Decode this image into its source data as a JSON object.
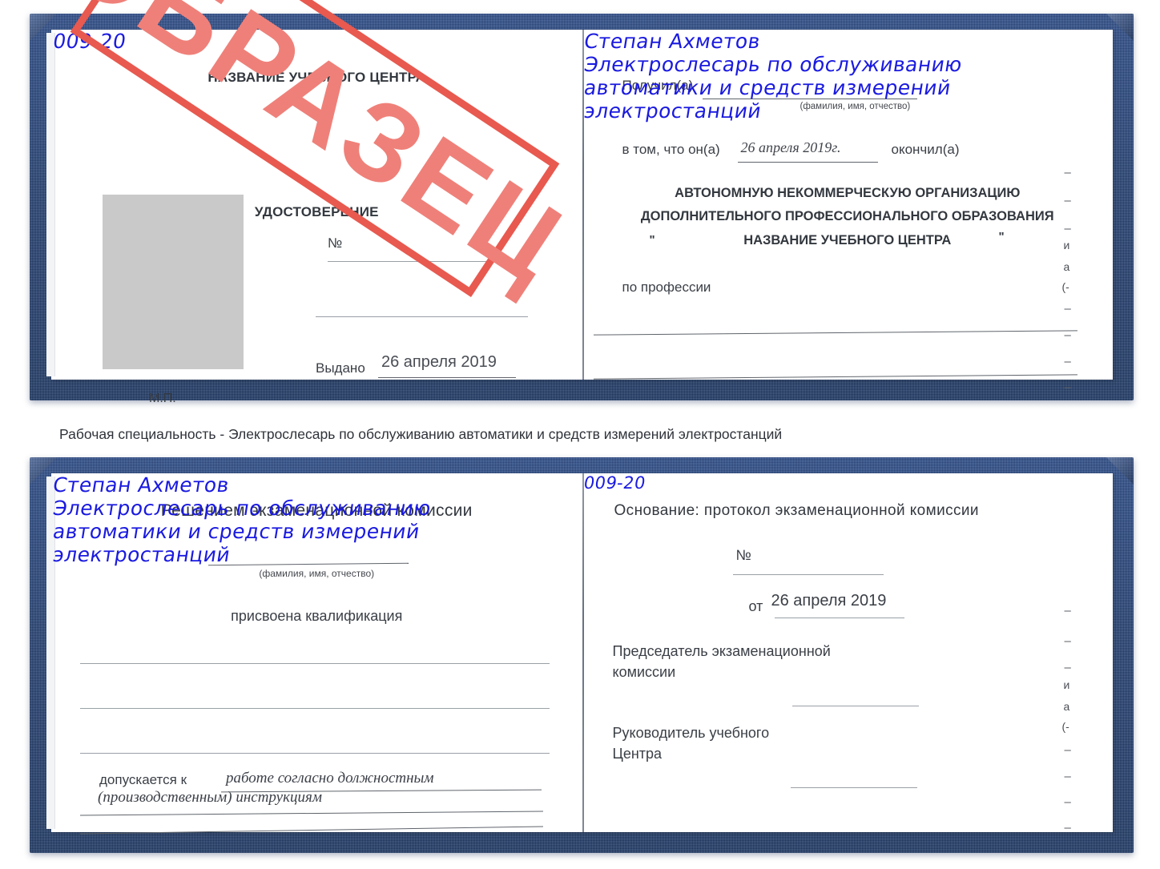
{
  "document": {
    "type": "certificate-spread",
    "stamp_text": "ОБРАЗЕЦ",
    "stamp_color": "#e8594f",
    "handwriting_color": "#1a1ae0",
    "cover_color": "#254377"
  },
  "caption": {
    "text": "Рабочая специальность - Электрослесарь по обслуживанию автоматики и средств измерений электростанций"
  },
  "certificate_top": {
    "left_page": {
      "header": "НАЗВАНИЕ УЧЕБНОГО ЦЕНТРА",
      "title": "УДОСТОВЕРЕНИЕ",
      "number_label": "№",
      "number_value": "009-20",
      "issued_label": "Выдано",
      "issued_value": "26 апреля 2019",
      "seal_label": "М.П."
    },
    "right_page": {
      "received_label": "Получил(а)",
      "received_value": "Степан Ахметов",
      "received_hint": "(фамилия, имя, отчество)",
      "that_he_label": "в том, что он(а)",
      "that_he_value": "26 апреля 2019г.",
      "finished_label": "окончил(а)",
      "organization_line1": "АВТОНОМНУЮ НЕКОММЕРЧЕСКУЮ ОРГАНИЗАЦИЮ",
      "organization_line2": "ДОПОЛНИТЕЛЬНОГО ПРОФЕССИОНАЛЬНОГО ОБРАЗОВАНИЯ",
      "organization_quote_open": "\"",
      "organization_line3": "НАЗВАНИЕ УЧЕБНОГО ЦЕНТРА",
      "organization_quote_close": "\"",
      "profession_label": "по профессии",
      "profession_line1": "Электрослесарь по обслуживанию",
      "profession_line2": "автоматики и средств измерений",
      "profession_line3": "электростанций",
      "edge_fragments": [
        "–",
        "–",
        "–",
        "и",
        "а",
        "(-",
        "–",
        "–",
        "–",
        "–"
      ]
    }
  },
  "certificate_bottom": {
    "left_page": {
      "header": "Решением экзаменационной комиссии",
      "name_value": "Степан Ахметов",
      "name_hint": "(фамилия, имя, отчество)",
      "qualification_label": "присвоена квалификация",
      "qualification_line1": "Электрослесарь по обслуживанию",
      "qualification_line2": "автоматики и средств измерений",
      "qualification_line3": "электростанций",
      "admitted_label": "допускается к",
      "admitted_value_line1": "работе согласно должностным",
      "admitted_value_line2": "(производственным) инструкциям"
    },
    "right_page": {
      "basis_label": "Основание: протокол экзаменационной комиссии",
      "protocol_number_label": "№",
      "protocol_number_value": "009-20",
      "protocol_date_label": "от",
      "protocol_date_value": "26 апреля 2019",
      "chairman_line1": "Председатель экзаменационной",
      "chairman_line2": "комиссии",
      "head_line1": "Руководитель учебного",
      "head_line2": "Центра",
      "edge_fragments": [
        "–",
        "–",
        "–",
        "и",
        "а",
        "(-",
        "–",
        "–",
        "–",
        "–"
      ]
    }
  }
}
